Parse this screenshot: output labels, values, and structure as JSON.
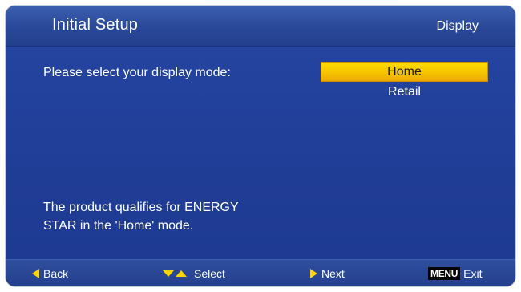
{
  "header": {
    "title": "Initial Setup",
    "section": "Display"
  },
  "main": {
    "prompt": "Please select your display mode:",
    "options": [
      {
        "label": "Home",
        "selected": true
      },
      {
        "label": "Retail",
        "selected": false
      }
    ],
    "note_line1": "The product qualifies for ENERGY",
    "note_line2": "STAR in the 'Home' mode."
  },
  "footer": {
    "back_label": "Back",
    "select_label": "Select",
    "next_label": "Next",
    "menu_key": "MENU",
    "exit_label": "Exit"
  },
  "colors": {
    "background": "#223b93",
    "highlight": "#f6c300",
    "arrow": "#ffd400"
  },
  "icons": {
    "back": "triangle-left-icon",
    "select": "triangle-down-up-icon",
    "next": "triangle-right-icon"
  }
}
